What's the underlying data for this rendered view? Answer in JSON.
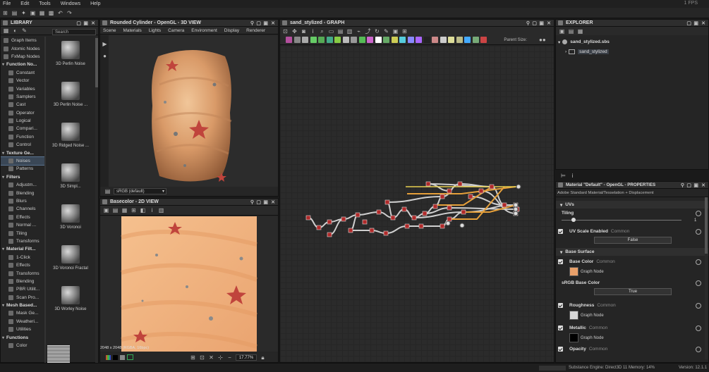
{
  "menu": {
    "items": [
      "File",
      "Edit",
      "Tools",
      "Windows",
      "Help"
    ],
    "fps": "1 FPS"
  },
  "library": {
    "title": "LIBRARY",
    "search_placeholder": "Search",
    "categories": [
      {
        "label": "Graph Items",
        "type": "item"
      },
      {
        "label": "Atomic Nodes",
        "type": "item"
      },
      {
        "label": "FxMap Nodes",
        "type": "item"
      },
      {
        "label": "Function No...",
        "type": "head"
      },
      {
        "label": "Constant",
        "type": "sub"
      },
      {
        "label": "Vector",
        "type": "sub"
      },
      {
        "label": "Variables",
        "type": "sub"
      },
      {
        "label": "Samplers",
        "type": "sub"
      },
      {
        "label": "Cast",
        "type": "sub"
      },
      {
        "label": "Operator",
        "type": "sub"
      },
      {
        "label": "Logical",
        "type": "sub"
      },
      {
        "label": "Compari...",
        "type": "sub"
      },
      {
        "label": "Function",
        "type": "sub"
      },
      {
        "label": "Control",
        "type": "sub"
      },
      {
        "label": "Texture Ge...",
        "type": "head"
      },
      {
        "label": "Noises",
        "type": "sub-sel"
      },
      {
        "label": "Patterns",
        "type": "sub"
      },
      {
        "label": "Filters",
        "type": "head"
      },
      {
        "label": "Adjustm...",
        "type": "sub"
      },
      {
        "label": "Blending",
        "type": "sub"
      },
      {
        "label": "Blurs",
        "type": "sub"
      },
      {
        "label": "Channels",
        "type": "sub"
      },
      {
        "label": "Effects",
        "type": "sub"
      },
      {
        "label": "Normal ...",
        "type": "sub"
      },
      {
        "label": "Tiling",
        "type": "sub"
      },
      {
        "label": "Transforms",
        "type": "sub"
      },
      {
        "label": "Material Filt...",
        "type": "head"
      },
      {
        "label": "1-Click",
        "type": "sub"
      },
      {
        "label": "Effects",
        "type": "sub"
      },
      {
        "label": "Transforms",
        "type": "sub"
      },
      {
        "label": "Blending",
        "type": "sub"
      },
      {
        "label": "PBR Utilit...",
        "type": "sub"
      },
      {
        "label": "Scan Pro...",
        "type": "sub"
      },
      {
        "label": "Mesh Based...",
        "type": "head"
      },
      {
        "label": "Mask Ge...",
        "type": "sub"
      },
      {
        "label": "Weatheri...",
        "type": "sub"
      },
      {
        "label": "Utilities",
        "type": "sub"
      },
      {
        "label": "Functions",
        "type": "head"
      },
      {
        "label": "Color",
        "type": "sub"
      }
    ],
    "thumbs": [
      "3D Perlin Noise",
      "3D Perlin Noise ...",
      "3D Ridged Noise ...",
      "3D Simpl...",
      "3D Voronoi",
      "3D Voronoi Fractal",
      "3D Worley Noise"
    ]
  },
  "view3d": {
    "title": "Rounded Cylinder - OpenGL - 3D VIEW",
    "menu": [
      "Scene",
      "Materials",
      "Lights",
      "Camera",
      "Environment",
      "Display",
      "Renderer"
    ],
    "colorspace": "sRGB (default)"
  },
  "view2d": {
    "title": "Basecolor - 2D VIEW",
    "info": "2048 x 2048 (RGBA, 16bpc)",
    "zoom": "17.77%"
  },
  "graph": {
    "title": "sand_stylized - GRAPH",
    "parent_size_label": "Parent Size:"
  },
  "explorer": {
    "title": "EXPLORER",
    "package": "sand_stylized.sbs",
    "graph": "sand_stylized"
  },
  "properties": {
    "title": "Material \"Default\" - OpenGL - PROPERTIES",
    "subtitle": "Adobe Standard Material/Tesselation + Displacement",
    "sections": {
      "uvs": "UVs",
      "base_surface": "Base Surface"
    },
    "tiling_label": "Tiling",
    "tiling_value": "1",
    "uv_scale_label": "UV Scale Enabled",
    "common": "Common",
    "uv_scale_value": "False",
    "base_color_label": "Base Color",
    "graph_node": "Graph Node",
    "srgb_label": "sRGB Base Color",
    "srgb_value": "True",
    "roughness_label": "Roughness",
    "metallic_label": "Metallic",
    "opacity_label": "Opacity",
    "colors": {
      "base": "#e8a06a",
      "roughness": "#d8d8d8",
      "metallic": "#000000"
    }
  },
  "status": {
    "engine": "Substance Engine: Direct3D 11  Memory: 14%",
    "version": "Version: 12.1.1"
  }
}
